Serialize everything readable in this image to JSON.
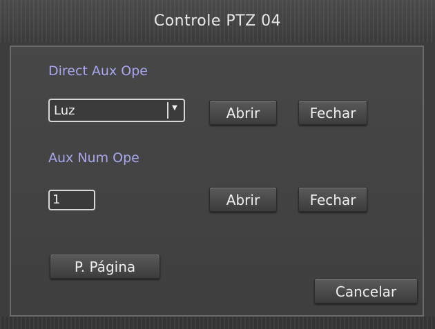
{
  "window": {
    "title": "Controle PTZ 04"
  },
  "direct_aux": {
    "label": "Direct Aux Ope",
    "select_value": "Luz",
    "open_label": "Abrir",
    "close_label": "Fechar"
  },
  "aux_num": {
    "label": "Aux Num Ope",
    "input_value": "1",
    "open_label": "Abrir",
    "close_label": "Fechar"
  },
  "footer": {
    "page_label": "P. Página",
    "cancel_label": "Cancelar"
  },
  "colors": {
    "label_accent": "#a8a8ee",
    "background": "#3d3d3d"
  }
}
